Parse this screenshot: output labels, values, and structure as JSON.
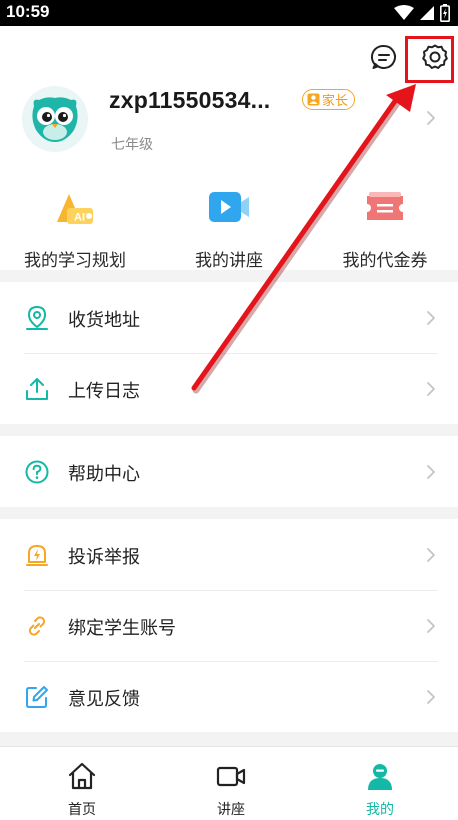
{
  "status_bar": {
    "time": "10:59"
  },
  "header": {
    "message_icon": "chat-bubble-icon",
    "settings_icon": "gear-icon",
    "highlight_color": "#e5141b"
  },
  "profile": {
    "username": "zxp11550534...",
    "role_badge": "家长",
    "grade": "七年级"
  },
  "quick_actions": [
    {
      "label": "我的学习规划",
      "icon": "ai-plan-icon"
    },
    {
      "label": "我的讲座",
      "icon": "video-lecture-icon"
    },
    {
      "label": "我的代金券",
      "icon": "voucher-icon"
    }
  ],
  "menu": {
    "section1": [
      {
        "label": "收货地址",
        "icon": "location-pin-icon"
      },
      {
        "label": "上传日志",
        "icon": "upload-icon"
      }
    ],
    "section2": [
      {
        "label": "帮助中心",
        "icon": "help-icon"
      }
    ],
    "section3": [
      {
        "label": "投诉举报",
        "icon": "report-icon"
      },
      {
        "label": "绑定学生账号",
        "icon": "link-icon"
      },
      {
        "label": "意见反馈",
        "icon": "feedback-icon"
      }
    ]
  },
  "bottom_nav": {
    "tabs": [
      {
        "label": "首页",
        "icon": "home-icon"
      },
      {
        "label": "讲座",
        "icon": "video-camera-icon"
      },
      {
        "label": "我的",
        "icon": "user-icon"
      }
    ],
    "active_index": 2,
    "active_color": "#14b8a6"
  },
  "colors": {
    "accent_teal": "#14b8a6",
    "badge_orange": "#f5a623",
    "annotation_red": "#e5141b"
  }
}
